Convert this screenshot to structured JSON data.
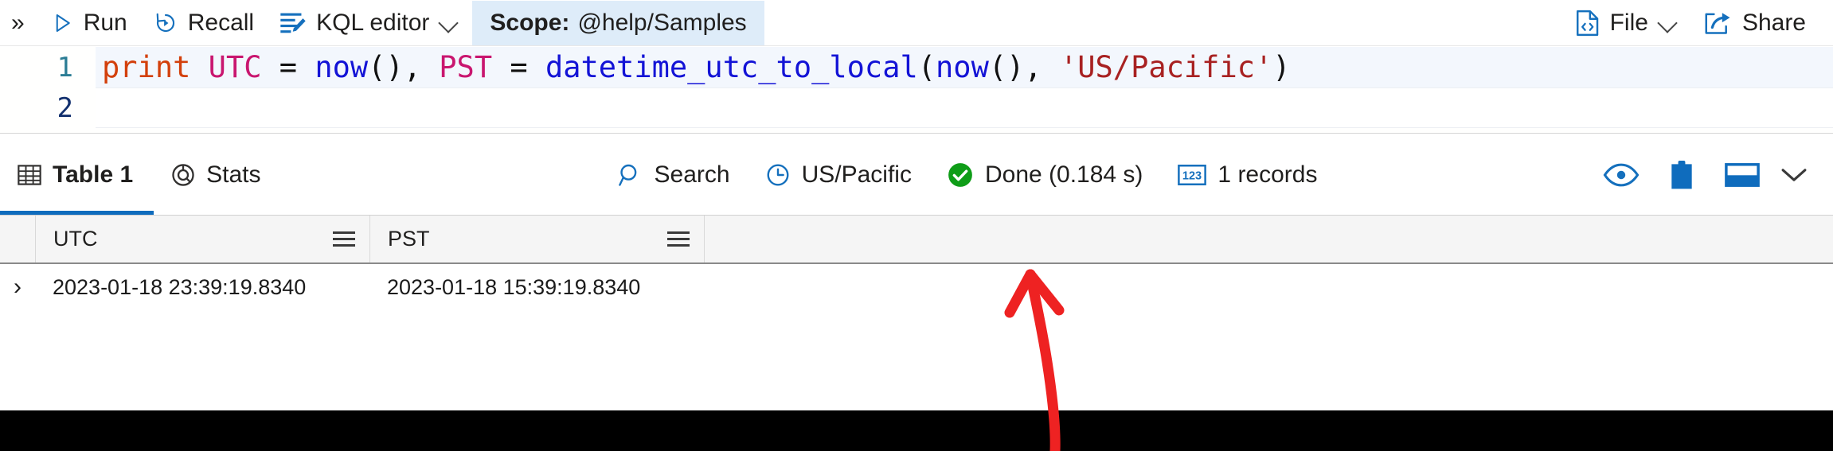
{
  "command_bar": {
    "overflow_label": "»",
    "items": [
      {
        "label": "Run",
        "icon": "play-icon"
      },
      {
        "label": "Recall",
        "icon": "recall-icon"
      },
      {
        "label": "KQL editor",
        "icon": "kql-editor-icon",
        "has_chevron": true
      }
    ],
    "scope": {
      "label": "Scope:",
      "value": "@help/Samples"
    },
    "right_items": [
      {
        "label": "File",
        "icon": "file-code-icon",
        "has_chevron": true
      },
      {
        "label": "Share",
        "icon": "share-icon",
        "has_chevron": false
      }
    ]
  },
  "editor": {
    "lines": [
      {
        "number": "1",
        "tokens": [
          {
            "text": "print",
            "type": "kw"
          },
          {
            "text": " ",
            "type": "pun"
          },
          {
            "text": "UTC",
            "type": "col"
          },
          {
            "text": " ",
            "type": "pun"
          },
          {
            "text": "=",
            "type": "op"
          },
          {
            "text": " ",
            "type": "pun"
          },
          {
            "text": "now",
            "type": "fn"
          },
          {
            "text": "(), ",
            "type": "pun"
          },
          {
            "text": "PST",
            "type": "col"
          },
          {
            "text": " ",
            "type": "pun"
          },
          {
            "text": "=",
            "type": "op"
          },
          {
            "text": " ",
            "type": "pun"
          },
          {
            "text": "datetime_utc_to_local",
            "type": "fn"
          },
          {
            "text": "(",
            "type": "pun"
          },
          {
            "text": "now",
            "type": "fn"
          },
          {
            "text": "(), ",
            "type": "pun"
          },
          {
            "text": "'US/Pacific'",
            "type": "str"
          },
          {
            "text": ")",
            "type": "pun"
          }
        ]
      },
      {
        "number": "2",
        "tokens": []
      }
    ],
    "full_text": "print UTC = now(), PST = datetime_utc_to_local(now(), 'US/Pacific')"
  },
  "results": {
    "tabs": [
      {
        "label": "Table 1",
        "icon": "table-icon",
        "active": true
      },
      {
        "label": "Stats",
        "icon": "stats-donut-icon",
        "active": false
      }
    ],
    "tools": [
      {
        "label": "Search",
        "icon": "search-icon"
      },
      {
        "label": "US/Pacific",
        "icon": "clock-icon"
      },
      {
        "label": "Done (0.184 s)",
        "icon": "success-check-icon"
      },
      {
        "label": "1 records",
        "icon": "numbers-123-icon"
      }
    ],
    "right_icons": [
      {
        "name": "eye-icon"
      },
      {
        "name": "clipboard-icon"
      },
      {
        "name": "panel-layout-icon"
      },
      {
        "name": "chevron-down-icon"
      }
    ]
  },
  "table": {
    "columns": [
      {
        "label": "UTC"
      },
      {
        "label": "PST"
      }
    ],
    "rows": [
      {
        "expander": "›",
        "cells": [
          "2023-01-18 23:39:19.8340",
          "2023-01-18 15:39:19.8340"
        ]
      }
    ]
  },
  "annotation": {
    "type": "arrow",
    "color": "#ee2222",
    "points_at": "US/Pacific"
  },
  "colors": {
    "accent": "#0f6cbd",
    "scope_pill_bg": "#deecf9",
    "success_green": "#107c10",
    "annotation_red": "#ee2222",
    "keyword_orange": "#d3400c",
    "column_magenta": "#c9166f",
    "function_blue": "#1313d6",
    "string_red": "#a82121",
    "line_number_teal": "#2b7d95",
    "line_number_active": "#12306e"
  }
}
